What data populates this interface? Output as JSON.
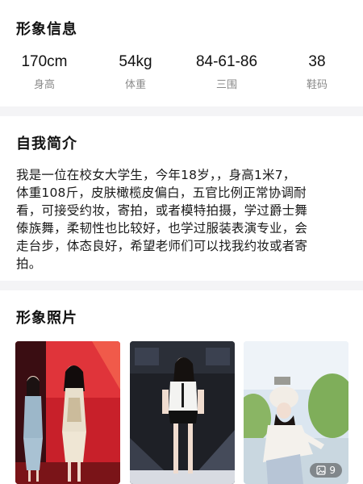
{
  "profile": {
    "title": "形象信息",
    "stats": [
      {
        "value": "170cm",
        "label": "身高"
      },
      {
        "value": "54kg",
        "label": "体重"
      },
      {
        "value": "84-61-86",
        "label": "三围"
      },
      {
        "value": "38",
        "label": "鞋码"
      }
    ]
  },
  "intro": {
    "title": "自我简介",
    "lines": [
      "我是一位在校女大学生，今年18岁，，身高1米7，",
      "体重108斤，皮肤橄榄皮偏白，五官比例正常协调耐",
      "看，可接受约妆，寄拍，或者模特拍摄，学过爵士舞",
      "傣族舞，柔韧性也比较好，也学过服装表演专业，会",
      "走台步，体态良好，希望老师们可以找我约妆或者寄",
      "拍。"
    ]
  },
  "photos": {
    "title": "形象照片",
    "count": "9",
    "items": [
      "photo-stage-qipao",
      "photo-stage-white-top",
      "photo-outdoor-fur-hat"
    ]
  }
}
